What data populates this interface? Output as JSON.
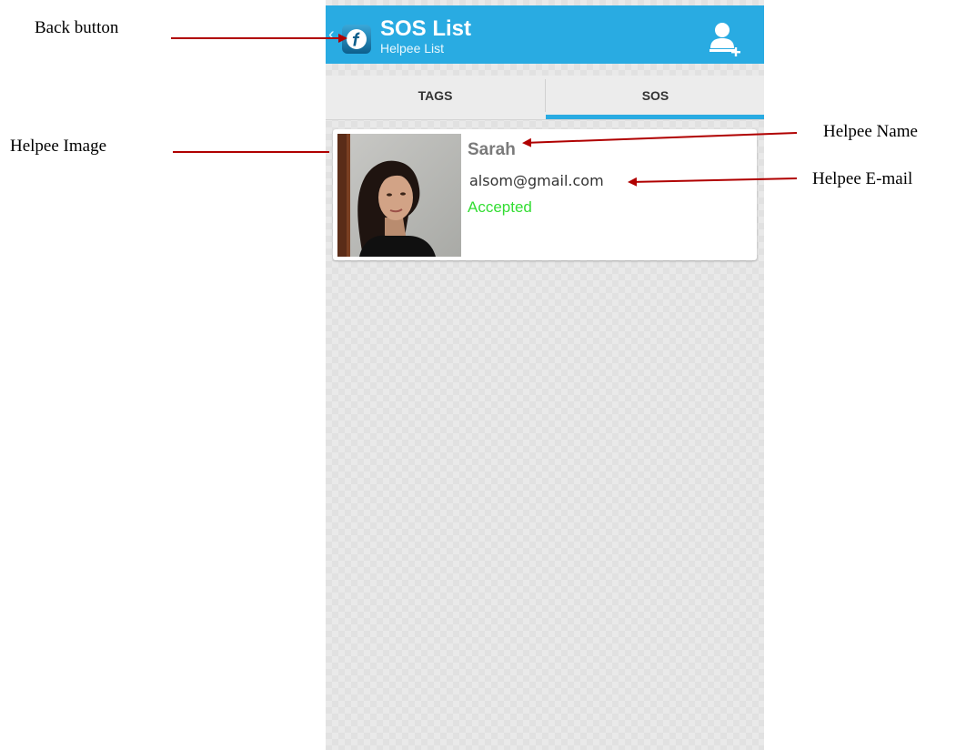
{
  "annotations": {
    "back_button": "Back button",
    "helpee_image": "Helpee Image",
    "helpee_name": "Helpee Name",
    "helpee_email": "Helpee E-mail",
    "arrow_color": "#b00000"
  },
  "action_bar": {
    "title": "SOS List",
    "subtitle": "Helpee List",
    "app_icon": "app-logo-f-icon",
    "action_icon": "add-user-icon",
    "color": "#29abe2"
  },
  "tabs": [
    {
      "label": "TAGS",
      "selected": false
    },
    {
      "label": "SOS",
      "selected": true
    }
  ],
  "helpees": [
    {
      "name": "Sarah",
      "email": "alsom@gmail.com",
      "status": "Accepted",
      "status_color": "#33dd33"
    }
  ]
}
